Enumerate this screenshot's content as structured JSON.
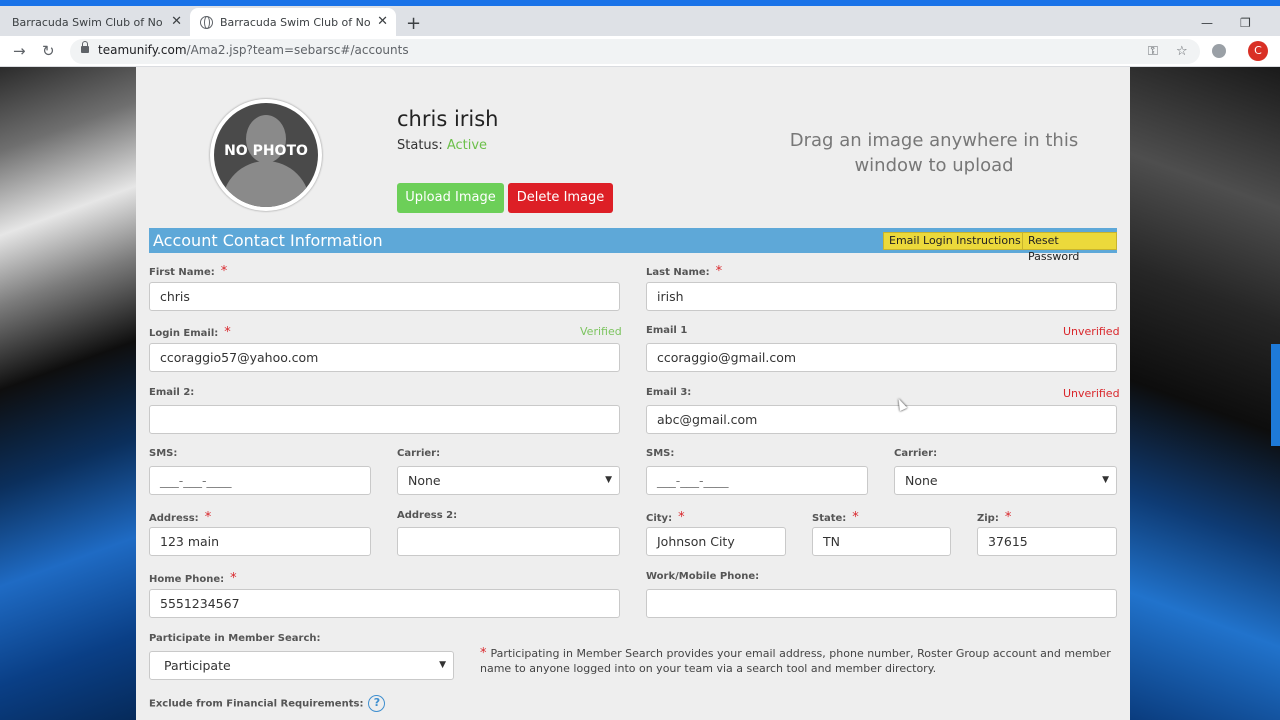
{
  "browser": {
    "tabs": [
      {
        "title": "Barracuda Swim Club of Northea"
      },
      {
        "title": "Barracuda Swim Club of Northea"
      }
    ],
    "url_host": "teamunify.com",
    "url_path": "/Ama2.jsp?team=sebarsc#/accounts",
    "profile_initial": "C"
  },
  "profile": {
    "photo_placeholder": "NO PHOTO",
    "name": "chris irish",
    "status_label": "Status:",
    "status_value": "Active",
    "upload_label": "Upload Image",
    "delete_label": "Delete Image",
    "drop_hint": "Drag an image anywhere in this window to upload"
  },
  "section": {
    "title": "Account Contact Information",
    "email_login_label": "Email Login Instructions",
    "reset_password_label": "Reset Password"
  },
  "form": {
    "first_name": {
      "label": "First Name:",
      "value": "chris"
    },
    "last_name": {
      "label": "Last Name:",
      "value": "irish"
    },
    "login_email": {
      "label": "Login Email:",
      "value": "ccoraggio57@yahoo.com",
      "status": "Verified"
    },
    "email1": {
      "label": "Email 1",
      "value": "ccoraggio@gmail.com",
      "status": "Unverified"
    },
    "email2": {
      "label": "Email 2:",
      "value": ""
    },
    "email3": {
      "label": "Email 3:",
      "value": "abc@gmail.com",
      "status": "Unverified"
    },
    "sms1": {
      "label": "SMS:",
      "value": "___-___-____"
    },
    "carrier1": {
      "label": "Carrier:",
      "value": "None"
    },
    "sms2": {
      "label": "SMS:",
      "value": "___-___-____"
    },
    "carrier2": {
      "label": "Carrier:",
      "value": "None"
    },
    "address": {
      "label": "Address:",
      "value": "123 main"
    },
    "address2": {
      "label": "Address 2:",
      "value": ""
    },
    "city": {
      "label": "City:",
      "value": "Johnson City"
    },
    "state": {
      "label": "State:",
      "value": "TN"
    },
    "zip": {
      "label": "Zip:",
      "value": "37615"
    },
    "home_phone": {
      "label": "Home Phone:",
      "value": "5551234567"
    },
    "work_phone": {
      "label": "Work/Mobile Phone:",
      "value": ""
    },
    "member_search": {
      "label": "Participate in Member Search:",
      "value": "Participate"
    },
    "member_search_note": "Participating in Member Search provides your email address, phone number, Roster Group account and member name to anyone logged into on your team via a search tool and member directory.",
    "exclude_financial": {
      "label": "Exclude from Financial Requirements:"
    }
  },
  "required_mark": "*",
  "colors": {
    "accent_blue": "#5ea8d8",
    "success_green": "#6ccf58",
    "danger_red": "#dd1f26",
    "warning_yellow": "#ecd93b"
  }
}
